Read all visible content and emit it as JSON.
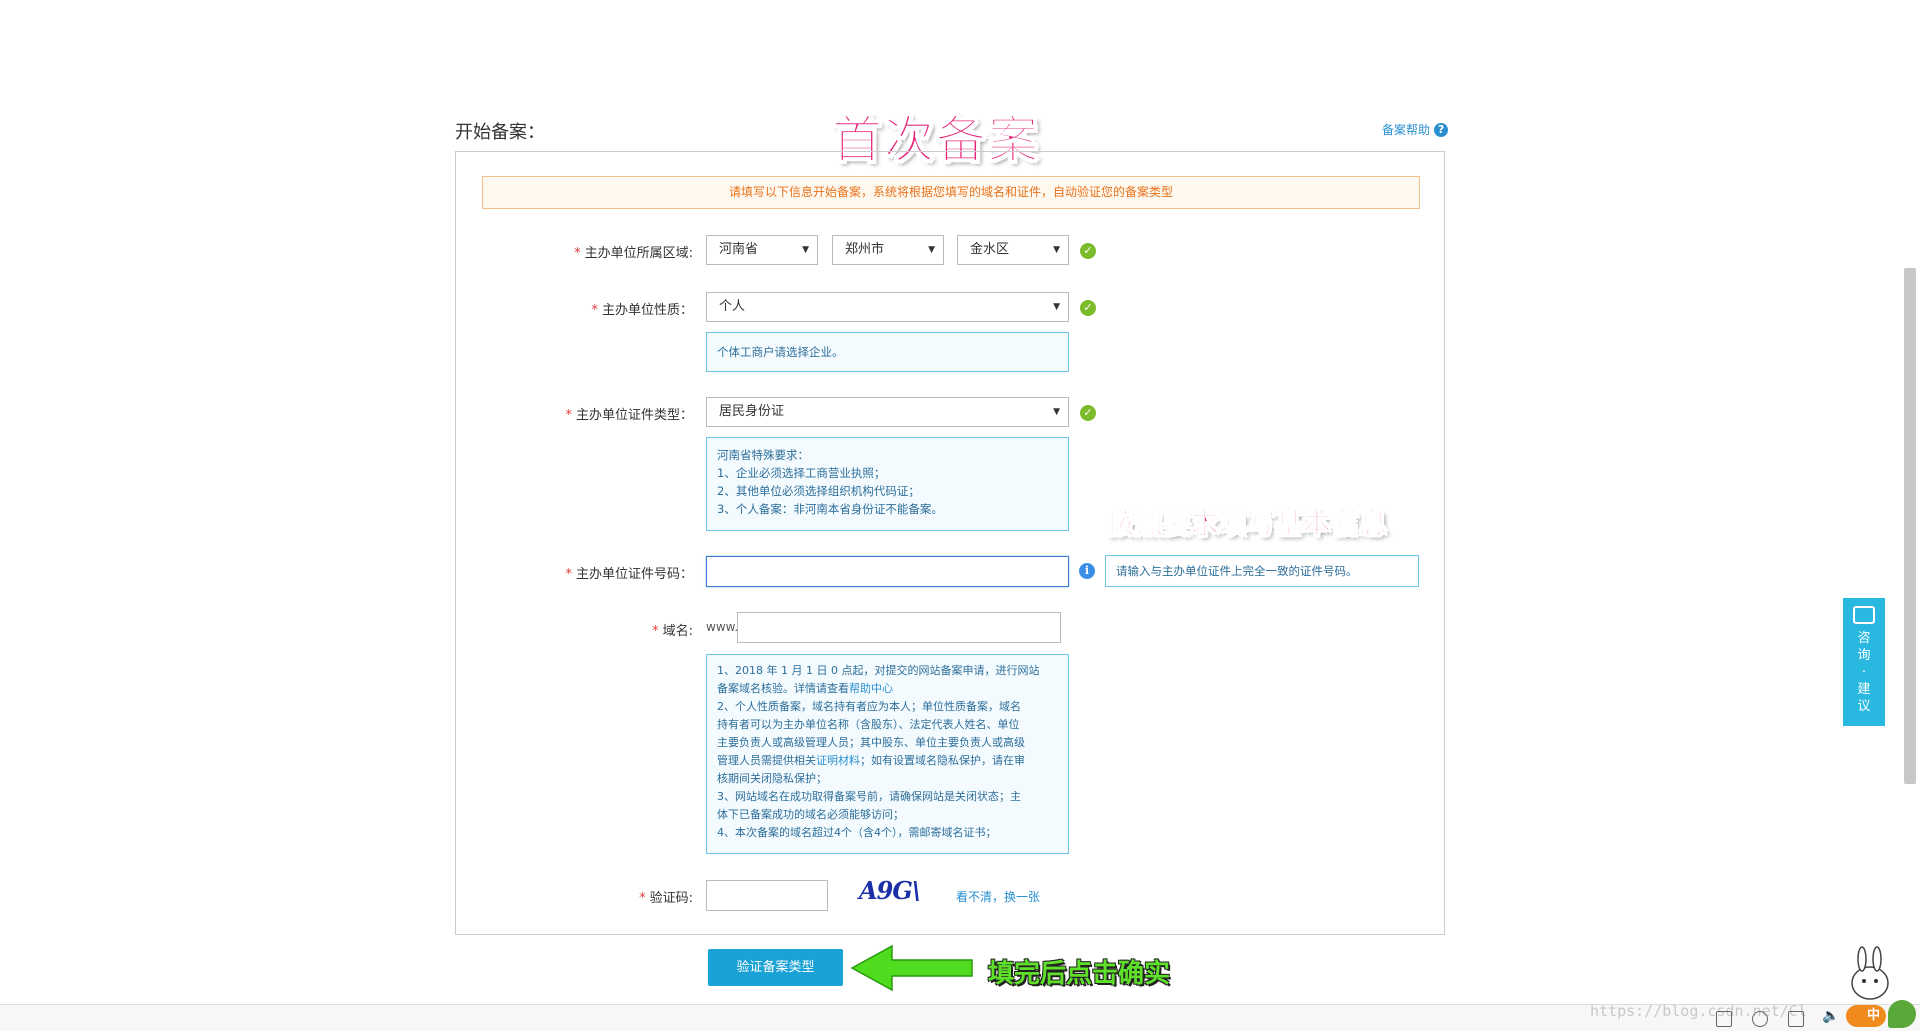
{
  "header": {
    "title": "开始备案：",
    "help_label": "备案帮助",
    "help_icon_glyph": "?"
  },
  "annotations": {
    "first_filing": "首次备案",
    "fill_basic": "按照要求填写基本信息",
    "click_confirm": "填完后点击确实"
  },
  "notice": "请填写以下信息开始备案，系统将根据您填写的域名和证件，自动验证您的备案类型",
  "form": {
    "region": {
      "label": "主办单位所属区域:",
      "province": "河南省",
      "city": "郑州市",
      "district": "金水区"
    },
    "nature": {
      "label": "主办单位性质：",
      "value": "个人",
      "tip": "个体工商户请选择企业。"
    },
    "cert_type": {
      "label": "主办单位证件类型：",
      "value": "居民身份证",
      "tips": [
        "河南省特殊要求：",
        "1、企业必须选择工商营业执照；",
        "2、其他单位必须选择组织机构代码证；",
        "3、个人备案：非河南本省身份证不能备案。"
      ]
    },
    "cert_number": {
      "label": "主办单位证件号码：",
      "value": "",
      "hint": "请输入与主办单位证件上完全一致的证件号码。"
    },
    "domain": {
      "label": "域名:",
      "prefix": "www.",
      "value": "",
      "tips": [
        "1、2018 年 1 月 1 日 0 点起，对提交的网站备案申请，进行网站",
        "备案域名核验。详情请查看",
        "帮助中心",
        "2、个人性质备案，域名持有者应为本人；单位性质备案，域名",
        "持有者可以为主办单位名称（含股东）、法定代表人姓名、单位",
        "主要负责人或高级管理人员；其中股东、单位主要负责人或高级",
        "管理人员需提供相关",
        "证明材料",
        "；如有设置域名隐私保护，请在审",
        "核期间关闭隐私保护；",
        "3、网站域名在成功取得备案号前，请确保网站是关闭状态；主",
        "体下已备案成功的域名必须能够访问；",
        "4、本次备案的域名超过4个（含4个），需邮寄域名证书；"
      ]
    },
    "captcha": {
      "label": "验证码:",
      "value": "",
      "image_text": "A9G\\",
      "refresh": "看不清，换一张"
    },
    "required_mark": "*",
    "submit": "验证备案类型"
  },
  "side_widget": {
    "chars": [
      "咨",
      "询",
      "·",
      "建",
      "议"
    ]
  },
  "watermark": "https://blog.csdn.net/Cl",
  "tray": {
    "ime_label": "中"
  },
  "colors": {
    "accent": "#1aa2d6",
    "notice_text": "#e8731e",
    "annotation_pink": "#e6237a",
    "annotation_green": "#5ee02a",
    "ok_green": "#7cbb2c"
  }
}
